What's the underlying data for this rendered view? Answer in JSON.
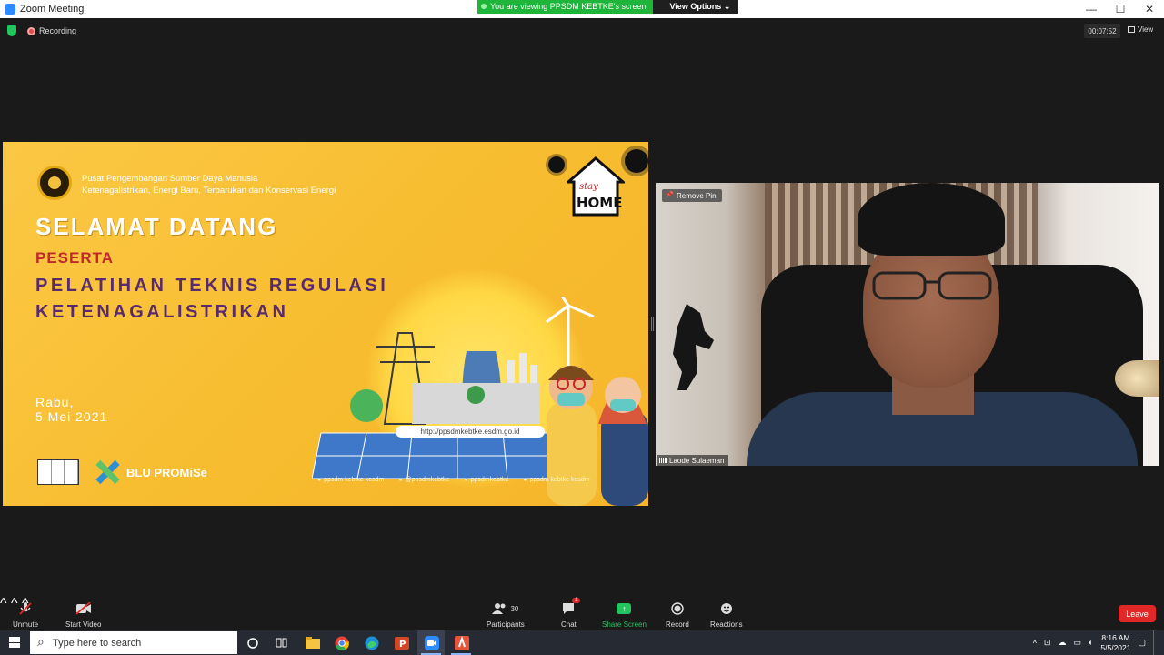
{
  "window": {
    "title": "Zoom Meeting",
    "controls": [
      "—",
      "☐",
      "✕"
    ]
  },
  "share_banner": {
    "viewing": "You are viewing PPSDM KEBTKE's screen",
    "options": "View Options ⌄"
  },
  "topbar": {
    "recording": "Recording",
    "timer": "00:07:52",
    "view": "View"
  },
  "slide": {
    "org_line1": "Pusat Pengembangan Sumber Daya Manusia",
    "org_line2": "Ketenagalistrikan, Energi Baru, Terbarukan dan Konservasi Energi",
    "welcome": "SELAMAT DATANG",
    "peserta": "PESERTA",
    "course_line1": "PELATIHAN TEKNIS REGULASI",
    "course_line2": "KETENAGALISTRIKAN",
    "day": "Rabu,",
    "date": "5 Mei 2021",
    "url": "http://ppsdmkebtke.esdm.go.id",
    "blu_logo": "BLU PROMiSe",
    "stay": "stay",
    "home": "HOME",
    "socials": [
      "ppsdm kebtke kesdm",
      "@ppsdmkebtke",
      "ppsdmkebtke",
      "ppsdm kebtke kesdm"
    ]
  },
  "video": {
    "pin": "Remove Pin",
    "name": "Laode Sulaeman"
  },
  "toolbar": {
    "unmute": "Unmute",
    "start_video": "Start Video",
    "participants": "Participants",
    "participants_count": "30",
    "chat": "Chat",
    "chat_badge": "1",
    "share": "Share Screen",
    "record": "Record",
    "reactions": "Reactions",
    "leave": "Leave"
  },
  "taskbar": {
    "search_placeholder": "Type here to search",
    "time": "8:16 AM",
    "date": "5/5/2021"
  },
  "colors": {
    "slide_yellow": "#f7bc2f",
    "share_green": "#23c55e",
    "leave_red": "#e02828",
    "course_purple": "#5a2a6e",
    "peserta_red": "#c1272d"
  }
}
